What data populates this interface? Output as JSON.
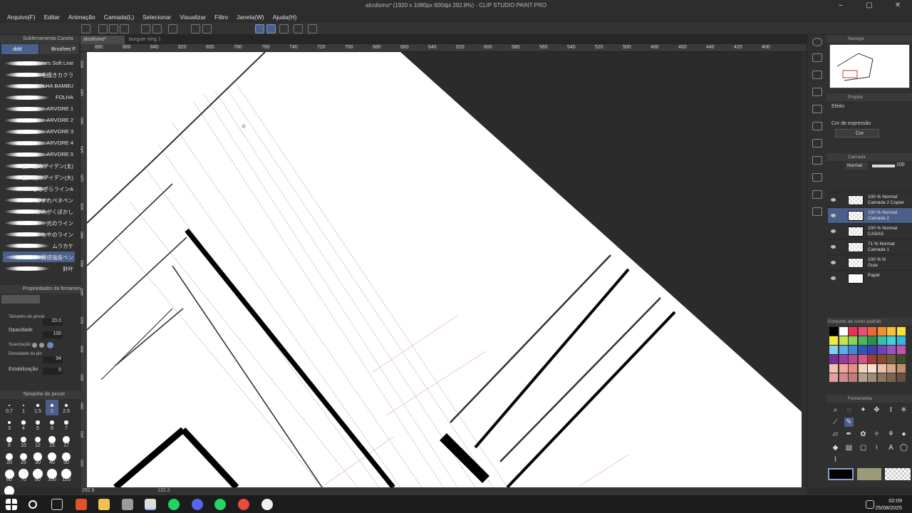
{
  "window": {
    "title": "alcolismo* (1920 x 1080px 600dpi 292.8%) - CLIP STUDIO PAINT PRO"
  },
  "menu": [
    "Arquivo(F)",
    "Editar",
    "Animação",
    "Camada(L)",
    "Selecionar",
    "Visualizar",
    "Filtro",
    "Janela(W)",
    "Ajuda(H)"
  ],
  "subtool": {
    "panel_title": "Subferramenta Caneta",
    "tab_ddd": "ddd",
    "tab_brushes": "Brushes F",
    "brushes": [
      "Eevee's Soft Line",
      "毛描きカクラ",
      "FOLHA BAMBU",
      "FOLHA",
      "ARVORE 1",
      "ARVORE 2",
      "ARVORE 3",
      "ARVORE 4",
      "ARVORE 5",
      "鋭い線のアイデン(太)",
      "鋭い線のアイデン(大)",
      "ざらざらラインA",
      "かすれペタペン",
      "つかみがくぼかし",
      "光のライン",
      "もやのライン",
      "ムラカケ",
      "質感強度ペン",
      "針叶"
    ]
  },
  "tool_props": {
    "title": "Propriedades da ferramen",
    "brush_size_label": "Tamanho do pincel",
    "brush_size": "20.0",
    "opacity_label": "Opacidade",
    "opacity": "100",
    "smoothing_label": "Suavização",
    "density_label": "Densidade do pin",
    "density": "94",
    "stabilization_label": "Estabilização",
    "stabilization": "0"
  },
  "brush_size_panel": {
    "title": "Tamanho do pincel",
    "sizes": [
      "0.7",
      "1",
      "1.5",
      "2",
      "2.5",
      "3",
      "4",
      "5",
      "6",
      "7",
      "8",
      "10",
      "12",
      "15",
      "17",
      "20",
      "25",
      "30",
      "40",
      "50",
      "60",
      "70",
      "80",
      "100",
      "120",
      "150"
    ]
  },
  "canvas": {
    "tabs": [
      "alcolismo*",
      "burguer king 1"
    ],
    "ruler_labels": [
      "880",
      "860",
      "840",
      "820",
      "800",
      "780",
      "760",
      "740",
      "720",
      "700",
      "680",
      "660",
      "640",
      "620",
      "600",
      "580",
      "560",
      "540",
      "520",
      "500",
      "480",
      "460",
      "440",
      "420",
      "400"
    ],
    "vruler_labels": [
      "600",
      "580",
      "560",
      "540",
      "520",
      "500",
      "480",
      "460",
      "440",
      "420",
      "400",
      "380",
      "360",
      "340",
      "320"
    ],
    "zoom": "292.8",
    "angle": "132.2"
  },
  "right": {
    "navigator_title": "Navega",
    "props_title": "Proprie",
    "effect_label": "Efeito",
    "expression_color_label": "Cor de expressão",
    "color_mode": "Cor",
    "layer_panel_title": "Camada",
    "blend_mode": "Normal",
    "opacity_value": "100",
    "layers": [
      {
        "line1": "100 % Normal",
        "line2": "Camada 2 Copiar"
      },
      {
        "line1": "100 % Normal",
        "line2": "Camada 2"
      },
      {
        "line1": "100 % Normal",
        "line2": "CASAS"
      },
      {
        "line1": "71 % Normal",
        "line2": "Camada 1"
      },
      {
        "line1": "100 % N",
        "line2": "Guia"
      },
      {
        "line1": "",
        "line2": "Papel"
      }
    ],
    "colorset_title": "Conjunto de cores padrão",
    "swatches": [
      "#000000",
      "#ffffff",
      "#e8334f",
      "#ee4b7b",
      "#e86a3a",
      "#ef9130",
      "#f5c13a",
      "#f6e23e",
      "#f3ea3c",
      "#c7e34a",
      "#88d35a",
      "#4ab85b",
      "#2e8f4d",
      "#35c0a8",
      "#3fd2d6",
      "#33b6e6",
      "#7fd2ef",
      "#57b1ea",
      "#3d86d8",
      "#2a57b8",
      "#3b3fb0",
      "#6b45b5",
      "#9a52c2",
      "#c153b0",
      "#7a2e9e",
      "#9a3aa5",
      "#b7498f",
      "#d4538b",
      "#a43b3b",
      "#8a4b2c",
      "#6f5d3a",
      "#3f4a2e",
      "#f2c1b0",
      "#f0a89a",
      "#e88f84",
      "#f5d1c0",
      "#f8dfcf",
      "#e8c4a8",
      "#d7a98a",
      "#c48d6d",
      "#e2a0a0",
      "#d18a8a",
      "#c27b7b",
      "#b3a08d",
      "#a38a74",
      "#8d7460",
      "#7a6552",
      "#66523f"
    ],
    "tool_panel_title": "Ferramenta",
    "main_color": "#000000",
    "sub_color": "#9b9b7a"
  },
  "taskbar": {
    "time": "02:09",
    "date": "25/08/2025"
  }
}
